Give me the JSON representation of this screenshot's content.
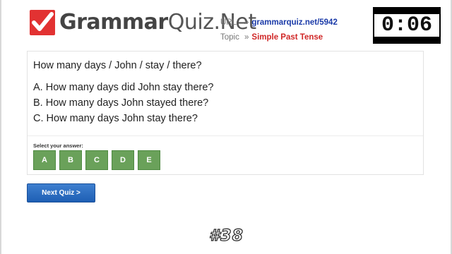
{
  "brand": {
    "name_bold": "Grammar",
    "name_light": "Quiz.Net",
    "accent": "#e23232"
  },
  "meta": {
    "url_label": "URL",
    "url_value": "grammarquiz.net/5942",
    "topic_label": "Topic",
    "topic_value": "Simple Past Tense",
    "separator": "»"
  },
  "timer": "0:06",
  "quiz": {
    "question": "How many days / John / stay / there?",
    "options": [
      "A. How many days did John stay there?",
      "B. How many days John stayed there?",
      "C. How many days John stay there?"
    ],
    "select_label": "Select your answer:",
    "answers": [
      "A",
      "B",
      "C",
      "D",
      "E"
    ]
  },
  "next_button": "Next Quiz >",
  "quiz_number": "#38",
  "colors": {
    "answer_green": "#6aa15a",
    "next_blue": "#2a6cc4",
    "url_blue": "#1a3aa8",
    "topic_red": "#d02828"
  }
}
